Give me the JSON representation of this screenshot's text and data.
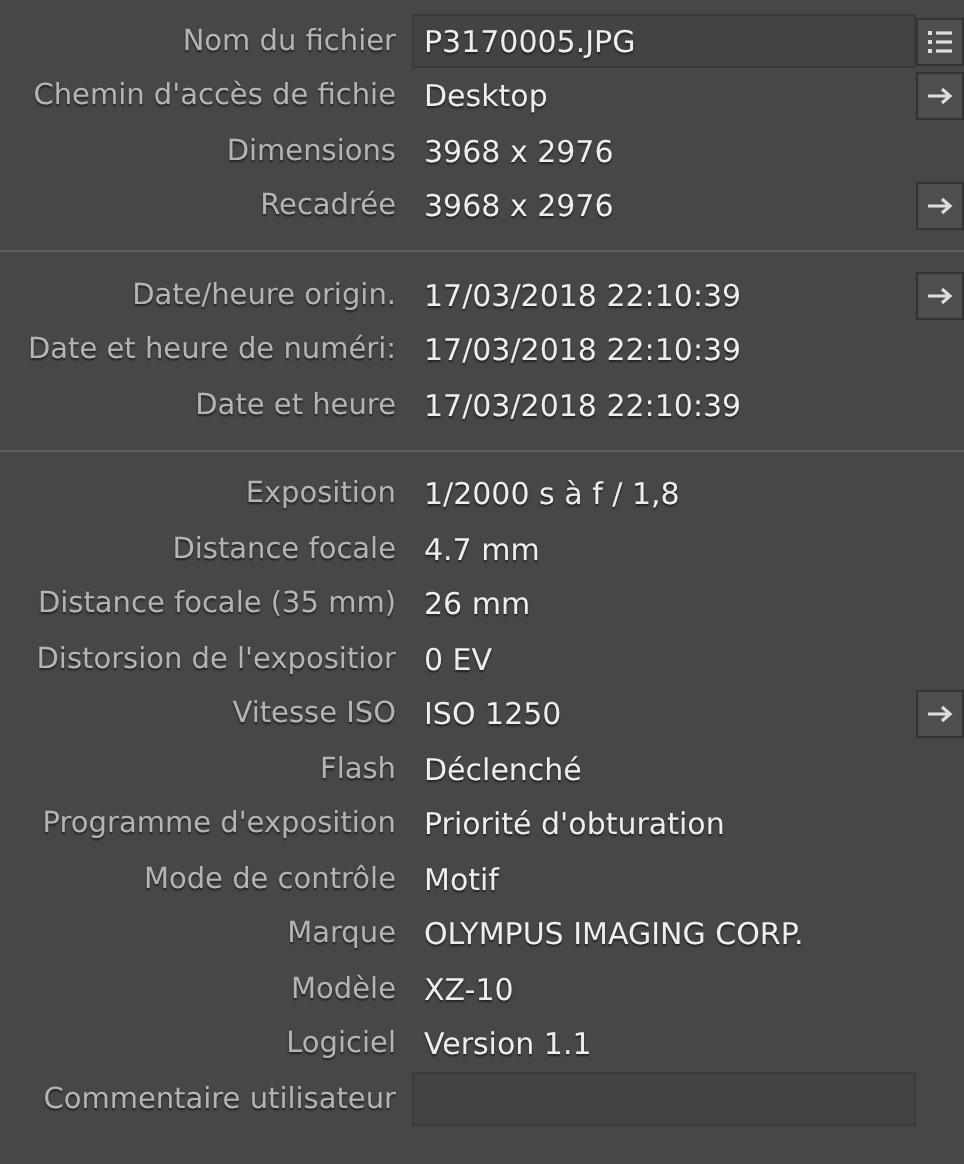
{
  "sections": [
    {
      "rows": [
        {
          "label": "Nom du fichier",
          "value": "P3170005.JPG",
          "kind": "field",
          "button": {
            "kind": "list"
          }
        },
        {
          "label": "Chemin d'accès de fichie",
          "value": "Desktop",
          "kind": "text",
          "button": {
            "kind": "arrow"
          }
        },
        {
          "label": "Dimensions",
          "value": "3968 x 2976",
          "kind": "text"
        },
        {
          "label": "Recadrée",
          "value": "3968 x 2976",
          "kind": "text",
          "button": {
            "kind": "arrow"
          }
        }
      ]
    },
    {
      "rows": [
        {
          "label": "Date/heure origin.",
          "value": "17/03/2018 22:10:39",
          "kind": "text",
          "button": {
            "kind": "arrow"
          }
        },
        {
          "label": "Date et heure de numéri:",
          "value": "17/03/2018 22:10:39",
          "kind": "text"
        },
        {
          "label": "Date et heure",
          "value": "17/03/2018 22:10:39",
          "kind": "text"
        }
      ]
    },
    {
      "rows": [
        {
          "label": "Exposition",
          "value": "1/2000 s à f / 1,8",
          "kind": "text"
        },
        {
          "label": "Distance focale",
          "value": "4.7 mm",
          "kind": "text"
        },
        {
          "label": "Distance focale (35 mm)",
          "value": "26 mm",
          "kind": "text"
        },
        {
          "label": "Distorsion de l'expositior",
          "value": "0 EV",
          "kind": "text"
        },
        {
          "label": "Vitesse ISO",
          "value": "ISO 1250",
          "kind": "text",
          "button": {
            "kind": "arrow"
          }
        },
        {
          "label": "Flash",
          "value": "Déclenché",
          "kind": "text"
        },
        {
          "label": "Programme d'exposition",
          "value": "Priorité d'obturation",
          "kind": "text"
        },
        {
          "label": "Mode de contrôle",
          "value": "Motif",
          "kind": "text"
        },
        {
          "label": "Marque",
          "value": "OLYMPUS IMAGING CORP.",
          "kind": "text"
        },
        {
          "label": "Modèle",
          "value": "XZ-10",
          "kind": "text"
        },
        {
          "label": "Logiciel",
          "value": "Version 1.1",
          "kind": "text"
        },
        {
          "label": "Commentaire utilisateur",
          "kind": "field"
        }
      ]
    }
  ]
}
